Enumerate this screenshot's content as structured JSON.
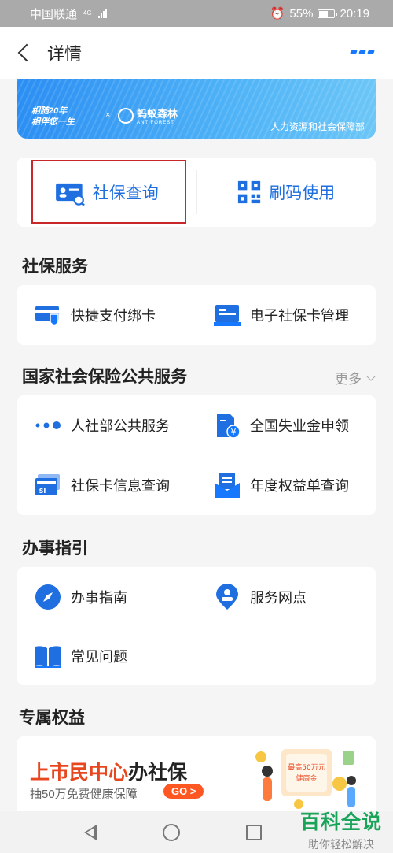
{
  "status_bar": {
    "carrier": "中国联通",
    "network": "4G",
    "battery": "55%",
    "time": "20:19"
  },
  "header": {
    "title": "详情"
  },
  "banner": {
    "slogan_line1": "相随20年",
    "slogan_line2": "相伴您一生",
    "separator": "×",
    "partner_cn": "蚂蚁森林",
    "partner_en": "ANT FOREST",
    "org": "人力资源和社会保障部"
  },
  "quick_actions": [
    {
      "label": "社保查询",
      "icon": "id-card-search-icon"
    },
    {
      "label": "刷码使用",
      "icon": "qr-code-icon"
    }
  ],
  "sections": {
    "social_security": {
      "title": "社保服务",
      "items": [
        {
          "label": "快捷支付绑卡",
          "icon": "card-shield-icon"
        },
        {
          "label": "电子社保卡管理",
          "icon": "e-card-icon"
        }
      ]
    },
    "national": {
      "title": "国家社会保险公共服务",
      "more": "更多",
      "items": [
        {
          "label": "人社部公共服务",
          "icon": "dots-icon"
        },
        {
          "label": "全国失业金申领",
          "icon": "yen-document-icon"
        },
        {
          "label": "社保卡信息查询",
          "icon": "si-card-icon"
        },
        {
          "label": "年度权益单查询",
          "icon": "envelope-doc-icon"
        }
      ]
    },
    "guide": {
      "title": "办事指引",
      "items": [
        {
          "label": "办事指南",
          "icon": "compass-icon"
        },
        {
          "label": "服务网点",
          "icon": "location-pin-icon"
        },
        {
          "label": "常见问题",
          "icon": "book-icon"
        }
      ]
    },
    "benefits": {
      "title": "专属权益"
    }
  },
  "promo": {
    "title_orange": "上市民中心",
    "title_dark": "办社保",
    "subtitle": "抽50万免费健康保障",
    "go": "GO >",
    "art_line1": "最高50万元",
    "art_line2": "健康金"
  },
  "watermark": {
    "main": "百科全说",
    "sub": "助你轻松解决"
  },
  "colors": {
    "accent": "#1677ff",
    "highlight_box": "#c8282a",
    "promo_orange": "#e8461e",
    "go_button": "#ff5722",
    "watermark_green": "#19a45a"
  }
}
